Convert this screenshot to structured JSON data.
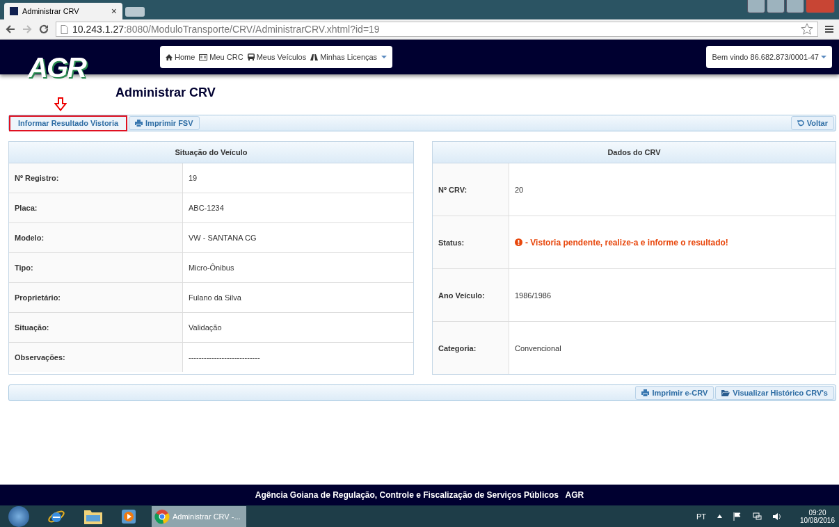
{
  "browser": {
    "tab_title": "Administrar CRV",
    "tab_close": "×",
    "url_host": "10.243.1.27",
    "url_rest": ":8080/ModuloTransporte/CRV/AdministrarCRV.xhtml?id=19"
  },
  "nav": {
    "logo": "AGR",
    "items": [
      {
        "label": "Home",
        "dropdown": false
      },
      {
        "label": "Meu CRC",
        "dropdown": false
      },
      {
        "label": "Meus Veículos",
        "dropdown": false
      },
      {
        "label": "Minhas Licenças",
        "dropdown": true
      }
    ],
    "user": "Bem vindo 86.682.873/0001-47"
  },
  "page_title": "Administrar CRV",
  "actions": [
    {
      "label": "Informar Resultado Vistoria",
      "highlighted": true
    },
    {
      "label": "Imprimir FSV",
      "highlighted": false
    }
  ],
  "back_button": "Voltar",
  "vehicle": {
    "title": "Situação do Veículo",
    "rows": [
      {
        "label": "Nº Registro:",
        "value": "19"
      },
      {
        "label": "Placa:",
        "value": "ABC-1234"
      },
      {
        "label": "Modelo:",
        "value": "VW - SANTANA CG"
      },
      {
        "label": "Tipo:",
        "value": "Micro-Ônibus"
      },
      {
        "label": "Proprietário:",
        "value": "Fulano da Silva"
      },
      {
        "label": "Situação:",
        "value": "Validação"
      },
      {
        "label": "Observações:",
        "value": "----------------------------"
      }
    ]
  },
  "crv": {
    "title": "Dados do CRV",
    "rows": [
      {
        "label": "Nº CRV:",
        "value": "20",
        "kind": "text"
      },
      {
        "label": "Status:",
        "value": "- Vistoria pendente, realize-a e informe o resultado!",
        "kind": "alert"
      },
      {
        "label": "Ano Veículo:",
        "value": "1986/1986",
        "kind": "text"
      },
      {
        "label": "Categoria:",
        "value": "Convencional",
        "kind": "text"
      }
    ]
  },
  "bottom_actions": [
    {
      "label": "Imprimir e-CRV"
    },
    {
      "label": "Visualizar Histórico CRV's"
    }
  ],
  "footer": "Agência Goiana de Regulação, Controle e Fiscalização de Serviços Públicos   AGR",
  "taskbar": {
    "window": "Administrar CRV -...",
    "language": "PT",
    "time": "09:20",
    "date": "10/08/2016"
  }
}
